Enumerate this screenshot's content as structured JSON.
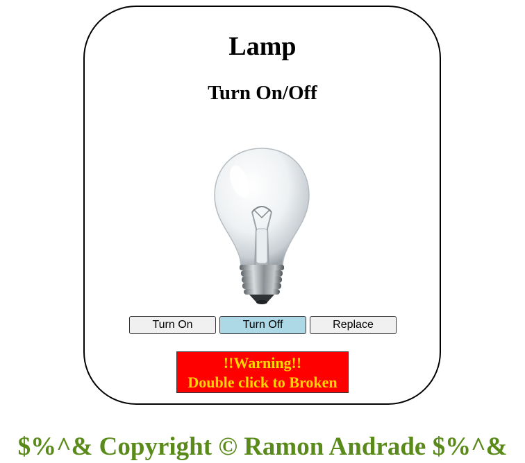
{
  "lamp": {
    "title": "Lamp",
    "subtitle": "Turn On/Off",
    "image": "light-bulb-off",
    "state": "off"
  },
  "controls": {
    "turn_on_label": "Turn On",
    "turn_off_label": "Turn Off",
    "replace_label": "Replace",
    "active": "turn_off"
  },
  "warning": {
    "line1": "!!Warning!!",
    "line2": "Double click to Broken",
    "background": "#ff0000",
    "text_color": "#ffd700"
  },
  "footer": {
    "text": "$%^& Copyright © Ramon Andrade $%^&",
    "color": "#5a8a1a"
  }
}
